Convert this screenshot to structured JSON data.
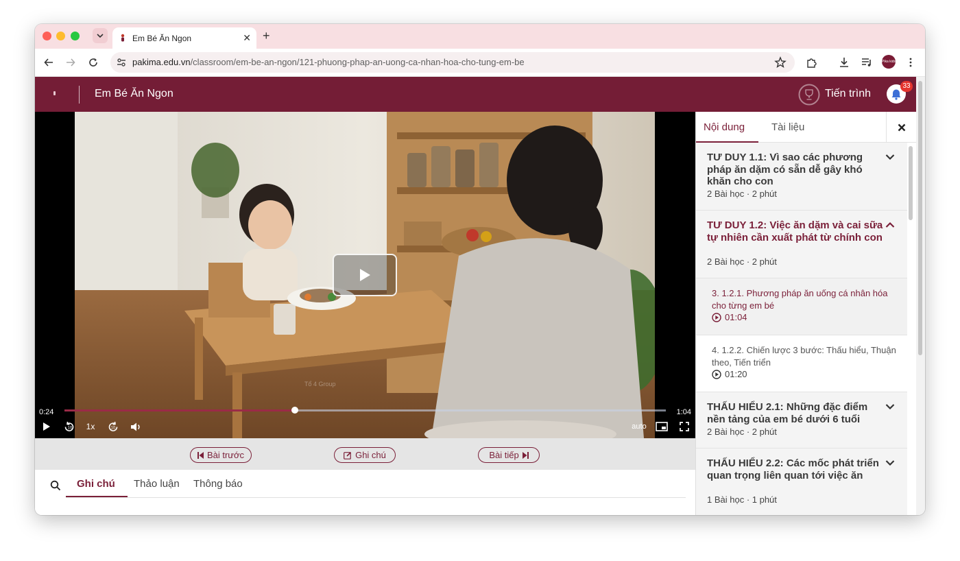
{
  "browser": {
    "tab_title": "Em Bé Ăn Ngon",
    "url_host": "pakima.edu.vn",
    "url_path": "/classroom/em-be-an-ngon/121-phuong-phap-an-uong-ca-nhan-hoa-cho-tung-em-be",
    "avatar_text": "Pika kids"
  },
  "header": {
    "course_title": "Em Bé Ăn Ngon",
    "progress_label": "Tiến trình",
    "notification_count": "33",
    "brand_color": "#741d36"
  },
  "video": {
    "current_time": "0:24",
    "total_time": "1:04",
    "progress_fraction": 0.383,
    "speed": "1x",
    "quality": "auto",
    "watermark": "Tổ 4 Group"
  },
  "lesson_nav": {
    "prev_label": "Bài trước",
    "note_label": "Ghi chú",
    "next_label": "Bài tiếp"
  },
  "lower_tabs": [
    {
      "label": "Ghi chú",
      "active": true
    },
    {
      "label": "Thảo luận",
      "active": false
    },
    {
      "label": "Thông báo",
      "active": false
    }
  ],
  "sidebar": {
    "tabs": [
      {
        "label": "Nội dung",
        "active": true
      },
      {
        "label": "Tài liệu",
        "active": false
      }
    ],
    "sections": [
      {
        "title": "TƯ DUY 1.1: Vì sao các phương pháp ăn dặm có sẵn dễ gây khó khăn cho con",
        "meta": "2 Bài học · 2 phút",
        "expanded": false
      },
      {
        "title": "TƯ DUY 1.2: Việc ăn dặm và cai sữa tự nhiên cần xuất phát từ chính con",
        "meta": "2 Bài học · 2 phút",
        "expanded": true
      },
      {
        "title": "THẤU HIỂU 2.1: Những đặc điểm nền tảng của em bé dưới 6 tuổi",
        "meta": "2 Bài học · 2 phút",
        "expanded": false
      },
      {
        "title": "THẤU HIỂU 2.2: Các mốc phát triển quan trọng liên quan tới việc ăn",
        "meta": "1 Bài học · 1 phút",
        "expanded": false
      }
    ],
    "lessons": [
      {
        "title": "3. 1.2.1. Phương pháp ăn uống cá nhân hóa cho từng em bé",
        "duration": "01:04",
        "active": true
      },
      {
        "title": "4. 1.2.2. Chiến lược 3 bước: Thấu hiểu, Thuận theo, Tiến triển",
        "duration": "01:20",
        "active": false
      }
    ]
  }
}
